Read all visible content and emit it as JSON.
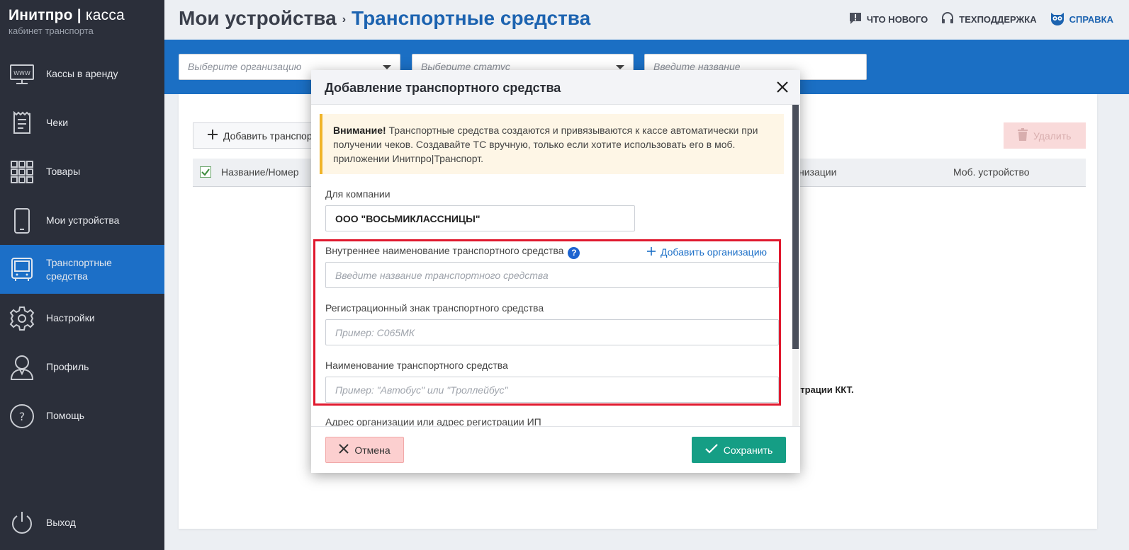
{
  "brand": {
    "title_bold": "Инитпро",
    "title_sep": "|",
    "title_light": "касса",
    "subtitle": "кабинет транспорта"
  },
  "sidebar": {
    "items": [
      {
        "label": "Кассы в аренду",
        "icon": "www-monitor-icon"
      },
      {
        "label": "Чеки",
        "icon": "receipt-icon"
      },
      {
        "label": "Товары",
        "icon": "grid-icon"
      },
      {
        "label": "Мои устройства",
        "icon": "phone-icon"
      },
      {
        "label": "Транспортные средства",
        "icon": "bus-icon",
        "active": true
      },
      {
        "label": "Настройки",
        "icon": "gear-icon"
      },
      {
        "label": "Профиль",
        "icon": "user-icon"
      },
      {
        "label": "Помощь",
        "icon": "question-icon"
      },
      {
        "label": "Выход",
        "icon": "power-icon"
      }
    ]
  },
  "header": {
    "breadcrumb_parent": "Мои устройства",
    "breadcrumb_sep": "›",
    "breadcrumb_current": "Транспортные средства",
    "links": {
      "whats_new": "ЧТО НОВОГО",
      "support": "ТЕХПОДДЕРЖКА",
      "help": "СПРАВКА"
    }
  },
  "filters": {
    "organization_placeholder": "Выберите организацию",
    "status_placeholder": "Выберите статус",
    "name_placeholder": "Введите название"
  },
  "content": {
    "add_button": "Добавить транспортное средство",
    "delete_button": "Удалить",
    "columns": {
      "name": "Название/Номер",
      "org": "низации",
      "device": "Моб. устройство"
    },
    "empty_text": "страции ККТ."
  },
  "modal": {
    "title": "Добавление транспортного средства",
    "notice_bold": "Внимание!",
    "notice_text": " Транспортные средства создаются и привязываются к кассе автоматически при получении чеков. Создавайте ТС вручную, только если хотите использовать его в моб. приложении Инитпро|Транспорт.",
    "company_label": "Для компании",
    "company_value": "ООО \"ВОСЬМИКЛАССНИЦЫ\"",
    "add_org": "Добавить организацию",
    "internal_name_label": "Внутреннее наименование транспортного средства",
    "internal_name_placeholder": "Введите название транспортного средства",
    "reg_sign_label": "Регистрационный знак транспортного средства",
    "reg_sign_placeholder": "Пример: С065МК",
    "vehicle_name_label": "Наименование транспортного средства",
    "vehicle_name_placeholder": "Пример: \"Автобус\" или \"Троллейбус\"",
    "address_label": "Адрес организации или адрес регистрации ИП",
    "cancel": "Отмена",
    "save": "Сохранить"
  },
  "colors": {
    "sidebar": "#2b2f3a",
    "accent": "#1b6fc4",
    "save": "#159e85",
    "cancel": "#fccfcf",
    "highlight": "#e0192e",
    "notice": "#fef6e6"
  }
}
